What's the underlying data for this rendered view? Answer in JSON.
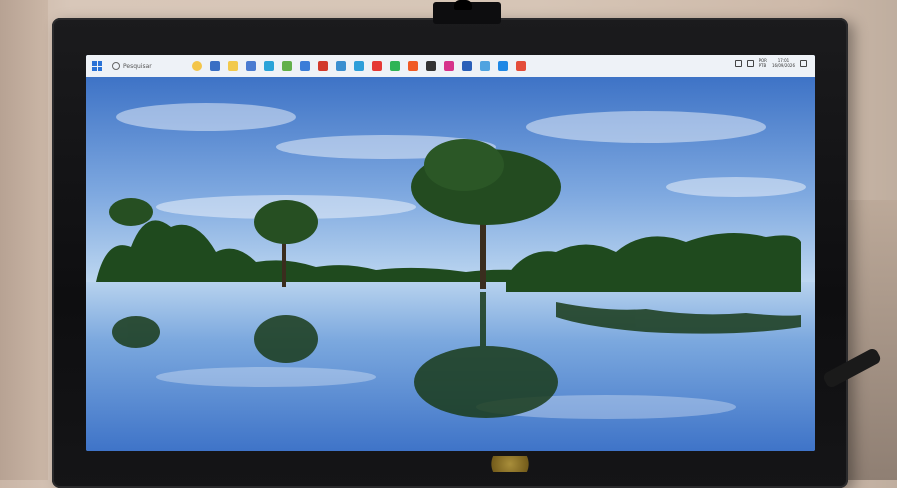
{
  "taskbar": {
    "search_placeholder": "Pesquisar",
    "apps": [
      {
        "icon": "widgets-icon",
        "color": "#f3c54a"
      },
      {
        "icon": "store-icon",
        "color": "#3a6fc4"
      },
      {
        "icon": "explorer-icon",
        "color": "#f2c94c"
      },
      {
        "icon": "settings-icon",
        "color": "#4a7bd1"
      },
      {
        "icon": "edge-icon",
        "color": "#2aa3d8"
      },
      {
        "icon": "notes-icon",
        "color": "#62b04a"
      },
      {
        "icon": "mail-icon",
        "color": "#3b7dd8"
      },
      {
        "icon": "pdf-icon",
        "color": "#d23a2c"
      },
      {
        "icon": "calculator-icon",
        "color": "#3a8fd0"
      },
      {
        "icon": "chat-icon",
        "color": "#2e9fd9"
      },
      {
        "icon": "youtube-icon",
        "color": "#e53935"
      },
      {
        "icon": "whatsapp-icon",
        "color": "#2fb457"
      },
      {
        "icon": "brave-icon",
        "color": "#f05a24"
      },
      {
        "icon": "terminal-icon",
        "color": "#333333"
      },
      {
        "icon": "instagram-icon",
        "color": "#d6338a"
      },
      {
        "icon": "app-icon",
        "color": "#2a5fb8"
      },
      {
        "icon": "photos-icon",
        "color": "#4fa3e0"
      },
      {
        "icon": "browser-icon",
        "color": "#1f88e5"
      },
      {
        "icon": "chrome-icon",
        "color": "#e44d3a"
      }
    ],
    "tray": {
      "lang_line1": "POR",
      "lang_line2": "PTB",
      "time": "17:01",
      "date": "16/09/2026"
    }
  },
  "colors": {
    "sky_top": "#3e73c6",
    "sky_bottom": "#b9d6f2",
    "water": "#4d8ed6",
    "trees": "#1f4a1e"
  }
}
